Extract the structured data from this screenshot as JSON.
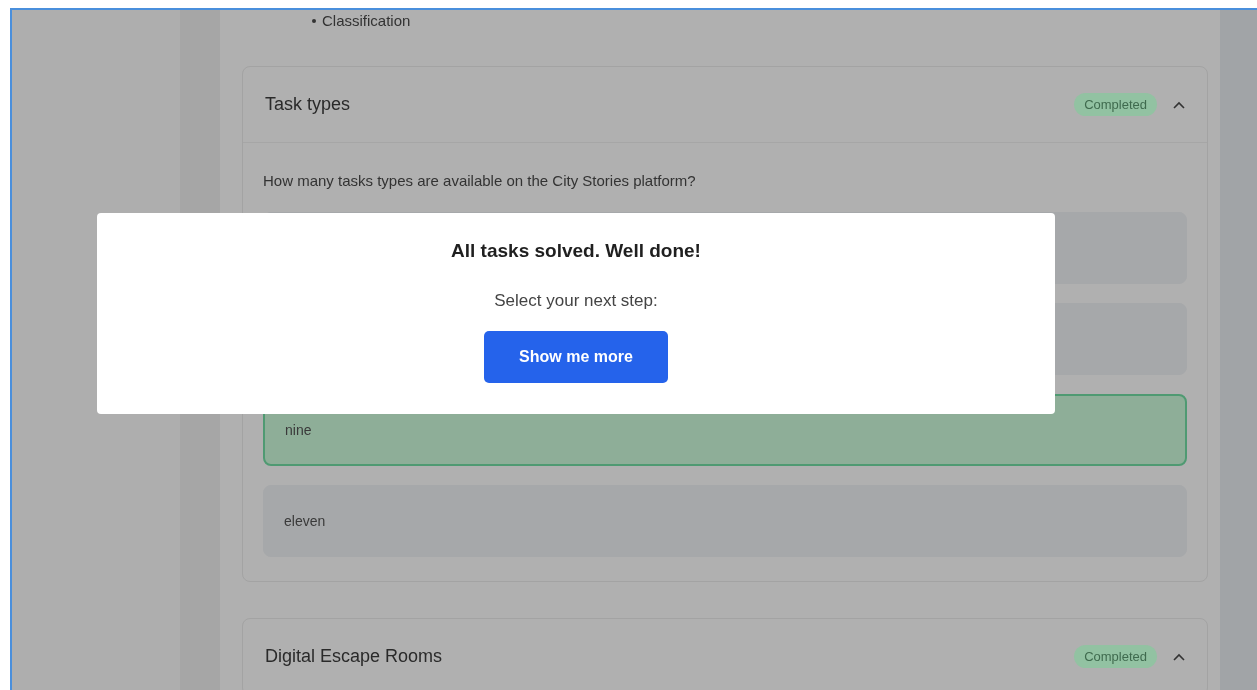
{
  "intro_list": [
    "Classification"
  ],
  "cards": [
    {
      "title": "Task types",
      "status": "Completed",
      "expanded": true,
      "question": "How many tasks types are available on the City Stories platform?",
      "options": [
        {
          "selected": false
        },
        {
          "selected": false
        },
        {
          "label": "nine",
          "selected": true
        },
        {
          "label": "eleven",
          "selected": false
        }
      ]
    },
    {
      "title": "Digital Escape Rooms",
      "status": "Completed",
      "expanded": true
    }
  ],
  "dialog": {
    "title": "All tasks solved. Well done!",
    "message": "Select your next step:",
    "button": "Show me more"
  }
}
